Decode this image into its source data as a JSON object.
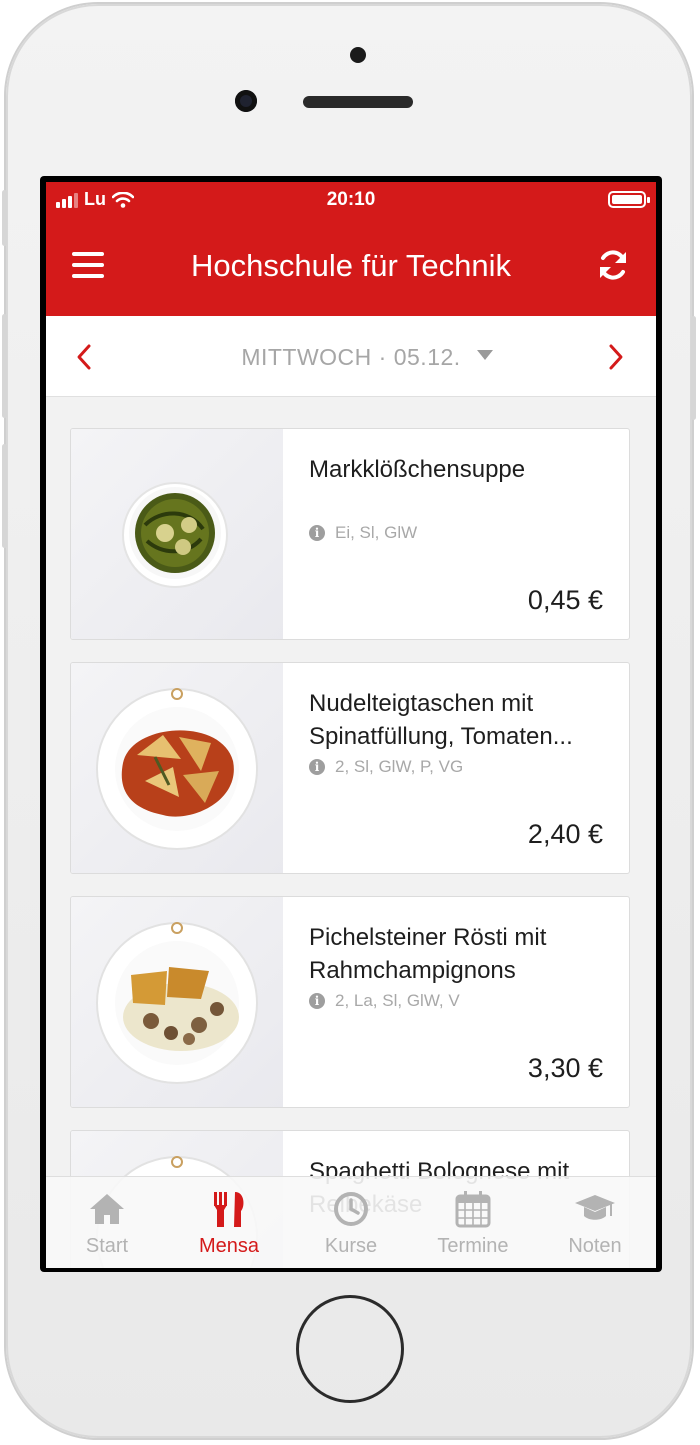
{
  "status_bar": {
    "carrier": "Lu",
    "time": "20:10"
  },
  "header": {
    "title": "Hochschule für Technik"
  },
  "date_selector": {
    "date": "MITTWOCH · 05.12."
  },
  "menu_items": [
    {
      "name": "Markklößchensuppe",
      "allergens": "Ei, Sl, GlW",
      "price": "0,45 €"
    },
    {
      "name": "Nudelteigtaschen mit Spinatfüllung, Tomaten...",
      "allergens": "2, Sl, GlW, P, VG",
      "price": "2,40 €"
    },
    {
      "name": "Pichelsteiner Rösti mit Rahmchampignons",
      "allergens": "2, La, Sl, GlW, V",
      "price": "3,30 €"
    },
    {
      "name": "Spaghetti Bolognese mit Reibekäse",
      "allergens": "",
      "price": ""
    }
  ],
  "tabs": [
    {
      "label": "Start",
      "icon": "home-icon",
      "active": false
    },
    {
      "label": "Mensa",
      "icon": "cutlery-icon",
      "active": true
    },
    {
      "label": "Kurse",
      "icon": "clock-icon",
      "active": false
    },
    {
      "label": "Termine",
      "icon": "calendar-icon",
      "active": false
    },
    {
      "label": "Noten",
      "icon": "graduation-cap-icon",
      "active": false
    }
  ],
  "colors": {
    "brand": "#d41a1a",
    "inactive_tab": "#b3b3b3"
  }
}
